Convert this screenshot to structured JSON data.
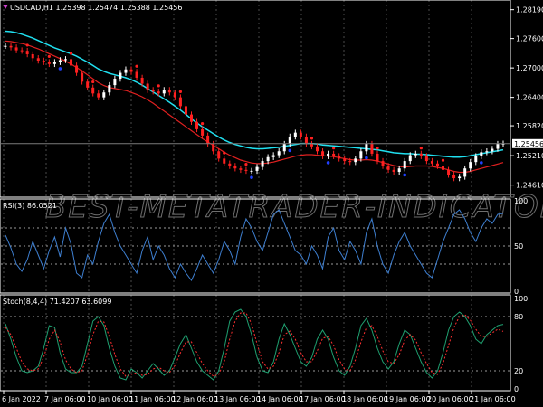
{
  "colors": {
    "background": "#000000",
    "grid": "#4a4a4a",
    "axis": "#ffffff",
    "candle": "#ffffff",
    "sell_signal": "#ff2020",
    "buy_signal": "#2040ff",
    "ma_fast": "#e02020",
    "ma_slow": "#20e0f0",
    "rsi_line": "#3e7fd0",
    "stoch_main": "#1fa070",
    "stoch_signal": "#ff3030",
    "level_line": "#9a9a9a"
  },
  "watermark": "BEST-METATRADER-INDICATORS.COM",
  "chart_data": [
    {
      "type": "line",
      "title": "USDCAD,H1  1.25398 1.25474 1.25388 1.25456",
      "subtype": "candlestick-overlay",
      "ylim": [
        1.244,
        1.2835
      ],
      "y_ticks": [
        "1.28190",
        "1.27600",
        "1.27000",
        "1.26400",
        "1.25820",
        "1.25210",
        "1.24610"
      ],
      "y_tick_values": [
        1.2819,
        1.276,
        1.27,
        1.264,
        1.2582,
        1.2521,
        1.2461
      ],
      "current_price_label": "1.25456",
      "current_price": 1.25456,
      "x_ticks": [
        "6 Jan 2022",
        "7 Jan 06:00",
        "10 Jan 06:00",
        "11 Jan 06:00",
        "12 Jan 06:00",
        "13 Jan 06:00",
        "14 Jan 06:00",
        "17 Jan 06:00",
        "18 Jan 06:00",
        "19 Jan 06:00",
        "20 Jan 06:00",
        "21 Jan 06:00"
      ],
      "price": [
        1.2745,
        1.2742,
        1.2736,
        1.2735,
        1.2728,
        1.272,
        1.2715,
        1.2712,
        1.2708,
        1.2712,
        1.2716,
        1.2718,
        1.2705,
        1.269,
        1.2672,
        1.266,
        1.2648,
        1.264,
        1.265,
        1.2665,
        1.2678,
        1.269,
        1.2697,
        1.2692,
        1.268,
        1.2668,
        1.2655,
        1.2652,
        1.2648,
        1.2655,
        1.265,
        1.264,
        1.2622,
        1.2605,
        1.259,
        1.2575,
        1.2562,
        1.2545,
        1.253,
        1.2515,
        1.2505,
        1.25,
        1.2495,
        1.2492,
        1.249,
        1.249,
        1.2498,
        1.251,
        1.2518,
        1.2522,
        1.253,
        1.2545,
        1.256,
        1.2568,
        1.256,
        1.2545,
        1.254,
        1.253,
        1.252,
        1.2525,
        1.252,
        1.2515,
        1.251,
        1.2508,
        1.2515,
        1.253,
        1.2545,
        1.2525,
        1.251,
        1.25,
        1.2492,
        1.2488,
        1.2495,
        1.251,
        1.2522,
        1.2525,
        1.252,
        1.251,
        1.2505,
        1.25,
        1.2492,
        1.2482,
        1.2475,
        1.2478,
        1.2495,
        1.2508,
        1.252,
        1.2528,
        1.253,
        1.2535,
        1.2545,
        1.25456
      ],
      "ma_slow": [
        1.2775,
        1.2774,
        1.2772,
        1.2769,
        1.2765,
        1.2761,
        1.2756,
        1.2751,
        1.2746,
        1.2741,
        1.2737,
        1.2733,
        1.2729,
        1.2724,
        1.2718,
        1.2712,
        1.2705,
        1.2698,
        1.2693,
        1.2689,
        1.2686,
        1.2683,
        1.268,
        1.2676,
        1.2671,
        1.2665,
        1.2658,
        1.2651,
        1.2644,
        1.2637,
        1.263,
        1.2622,
        1.2614,
        1.2605,
        1.2596,
        1.2588,
        1.258,
        1.2573,
        1.2566,
        1.2559,
        1.2553,
        1.2548,
        1.2544,
        1.2541,
        1.2538,
        1.2536,
        1.2535,
        1.2535,
        1.2536,
        1.2537,
        1.2538,
        1.254,
        1.2542,
        1.2544,
        1.2546,
        1.2546,
        1.2546,
        1.2545,
        1.2543,
        1.2542,
        1.2541,
        1.254,
        1.2539,
        1.2538,
        1.2537,
        1.2536,
        1.2535,
        1.2534,
        1.2533,
        1.2531,
        1.2529,
        1.2527,
        1.2526,
        1.2525,
        1.2525,
        1.2524,
        1.2524,
        1.2523,
        1.2522,
        1.2521,
        1.252,
        1.2519,
        1.2518,
        1.2518,
        1.2519,
        1.2521,
        1.2523,
        1.2525,
        1.2527,
        1.2529,
        1.2531,
        1.2533
      ],
      "ma_fast": [
        1.2755,
        1.2754,
        1.2752,
        1.275,
        1.2747,
        1.2743,
        1.2739,
        1.2734,
        1.2729,
        1.2724,
        1.2719,
        1.2714,
        1.2708,
        1.2701,
        1.2694,
        1.2686,
        1.2678,
        1.267,
        1.2664,
        1.266,
        1.2658,
        1.2656,
        1.2654,
        1.265,
        1.2646,
        1.2641,
        1.2635,
        1.2628,
        1.262,
        1.2612,
        1.2604,
        1.2596,
        1.2588,
        1.258,
        1.2572,
        1.2564,
        1.2556,
        1.2549,
        1.2542,
        1.2535,
        1.2528,
        1.2522,
        1.2517,
        1.2512,
        1.2509,
        1.2506,
        1.2505,
        1.2505,
        1.2506,
        1.2508,
        1.2511,
        1.2514,
        1.2517,
        1.252,
        1.2522,
        1.2523,
        1.2523,
        1.2522,
        1.2521,
        1.252,
        1.2519,
        1.2517,
        1.2515,
        1.2513,
        1.2512,
        1.2512,
        1.2513,
        1.2512,
        1.251,
        1.2507,
        1.2504,
        1.2501,
        1.2499,
        1.2498,
        1.2499,
        1.25,
        1.25,
        1.25,
        1.2499,
        1.2497,
        1.2495,
        1.2492,
        1.2489,
        1.2487,
        1.2487,
        1.2489,
        1.2492,
        1.2495,
        1.2498,
        1.2501,
        1.2504,
        1.2507
      ]
    },
    {
      "type": "line",
      "title": "RSI(3) 86.0521",
      "ylim": [
        0,
        100
      ],
      "y_ticks": [
        "100",
        "50",
        "0"
      ],
      "y_tick_values": [
        100,
        50,
        0
      ],
      "levels": [
        70,
        30
      ],
      "values": [
        62,
        48,
        30,
        22,
        35,
        55,
        40,
        25,
        45,
        60,
        38,
        70,
        52,
        20,
        15,
        40,
        30,
        55,
        75,
        85,
        65,
        50,
        40,
        30,
        20,
        45,
        60,
        35,
        50,
        40,
        25,
        15,
        30,
        20,
        12,
        25,
        40,
        30,
        20,
        35,
        55,
        45,
        30,
        60,
        80,
        70,
        55,
        45,
        65,
        85,
        90,
        75,
        60,
        45,
        40,
        30,
        50,
        40,
        25,
        60,
        70,
        45,
        35,
        55,
        45,
        30,
        65,
        80,
        50,
        30,
        20,
        40,
        55,
        65,
        50,
        40,
        30,
        20,
        15,
        35,
        55,
        70,
        85,
        90,
        80,
        65,
        55,
        70,
        80,
        75,
        85,
        86.05
      ]
    },
    {
      "type": "line",
      "title": "Stoch(8,4,4) 71.4207 63.6099",
      "ylim": [
        0,
        100
      ],
      "y_ticks": [
        "100",
        "80",
        "20",
        "0"
      ],
      "y_tick_values": [
        100,
        80,
        20,
        0
      ],
      "series": [
        {
          "name": "main",
          "values": [
            72,
            55,
            35,
            20,
            18,
            20,
            25,
            45,
            70,
            68,
            40,
            22,
            18,
            18,
            25,
            50,
            75,
            80,
            70,
            45,
            25,
            12,
            10,
            22,
            18,
            12,
            20,
            28,
            22,
            15,
            20,
            35,
            50,
            60,
            45,
            30,
            20,
            15,
            10,
            20,
            45,
            75,
            85,
            88,
            80,
            60,
            35,
            20,
            18,
            30,
            55,
            72,
            60,
            45,
            30,
            25,
            35,
            55,
            65,
            55,
            35,
            20,
            15,
            25,
            45,
            70,
            78,
            65,
            45,
            30,
            22,
            30,
            50,
            65,
            60,
            45,
            30,
            18,
            12,
            20,
            40,
            65,
            80,
            85,
            80,
            70,
            55,
            50,
            60,
            65,
            70,
            71.42
          ]
        },
        {
          "name": "signal",
          "values": [
            68,
            60,
            45,
            30,
            22,
            20,
            22,
            35,
            55,
            65,
            52,
            32,
            22,
            18,
            20,
            38,
            60,
            75,
            74,
            58,
            38,
            22,
            14,
            16,
            18,
            15,
            16,
            22,
            24,
            20,
            18,
            26,
            40,
            52,
            52,
            40,
            28,
            20,
            14,
            16,
            30,
            55,
            75,
            84,
            84,
            72,
            50,
            30,
            22,
            25,
            40,
            60,
            64,
            55,
            40,
            30,
            30,
            42,
            56,
            58,
            48,
            32,
            22,
            20,
            32,
            52,
            68,
            70,
            58,
            42,
            30,
            28,
            38,
            54,
            60,
            54,
            40,
            28,
            18,
            16,
            28,
            48,
            68,
            80,
            82,
            76,
            66,
            58,
            58,
            62,
            66,
            63.61
          ]
        }
      ]
    }
  ]
}
